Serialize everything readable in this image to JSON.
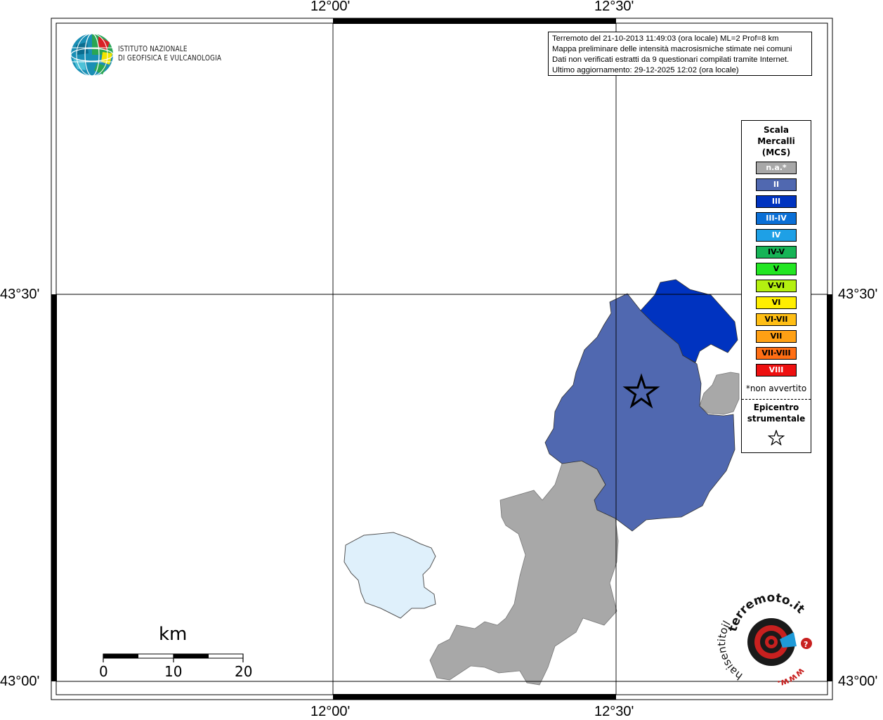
{
  "map": {
    "lon_labels": [
      "12°00'",
      "12°30'"
    ],
    "lat_labels": [
      "43°30'",
      "43°00'"
    ],
    "colors": {
      "intensity_II": "#5068b0",
      "intensity_III": "#0033c0",
      "not_felt": "#a8a8a8",
      "lake": "#dff0fb"
    }
  },
  "logo": {
    "line1": "ISTITUTO NAZIONALE",
    "line2": "DI GEOFISICA E VULCANOLOGIA"
  },
  "info": {
    "line1": "Terremoto del 21-10-2013 11:49:03 (ora locale) ML=2 Prof=8 km",
    "line2": "Mappa preliminare delle intensità macrosismiche stimate nei comuni",
    "line3": "Dati non verificati estratti da 9 questionari compilati tramite Internet.",
    "line4": "Ultimo aggiornamento: 29-12-2025 12:02 (ora locale)"
  },
  "legend": {
    "title_line1": "Scala",
    "title_line2": "Mercalli",
    "title_line3": "(MCS)",
    "items": [
      {
        "label": "n.a.*",
        "color": "#a8a8a8",
        "text_color": "#ffffff"
      },
      {
        "label": "II",
        "color": "#5068b0",
        "text_color": "#ffffff"
      },
      {
        "label": "III",
        "color": "#0033c0",
        "text_color": "#ffffff"
      },
      {
        "label": "III-IV",
        "color": "#0a6fd6",
        "text_color": "#ffffff"
      },
      {
        "label": "IV",
        "color": "#1ea0e6",
        "text_color": "#ffffff"
      },
      {
        "label": "IV-V",
        "color": "#16b456",
        "text_color": "#000000"
      },
      {
        "label": "V",
        "color": "#22e622",
        "text_color": "#000000"
      },
      {
        "label": "V-VI",
        "color": "#b4f010",
        "text_color": "#000000"
      },
      {
        "label": "VI",
        "color": "#ffee00",
        "text_color": "#000000"
      },
      {
        "label": "VI-VII",
        "color": "#ffbe14",
        "text_color": "#000000"
      },
      {
        "label": "VII",
        "color": "#ffa014",
        "text_color": "#000000"
      },
      {
        "label": "VII-VIII",
        "color": "#ff6e14",
        "text_color": "#000000"
      },
      {
        "label": "VIII",
        "color": "#ee1010",
        "text_color": "#ffffff"
      }
    ],
    "note": "*non avvertito",
    "epicenter_line1": "Epicentro",
    "epicenter_line2": "strumentale"
  },
  "scale_bar": {
    "unit": "km",
    "ticks": [
      "0",
      "10",
      "20"
    ]
  },
  "badge": {
    "text_top": "terremoto.it",
    "text_left": "haisentitoil",
    "text_bottom": "www."
  }
}
